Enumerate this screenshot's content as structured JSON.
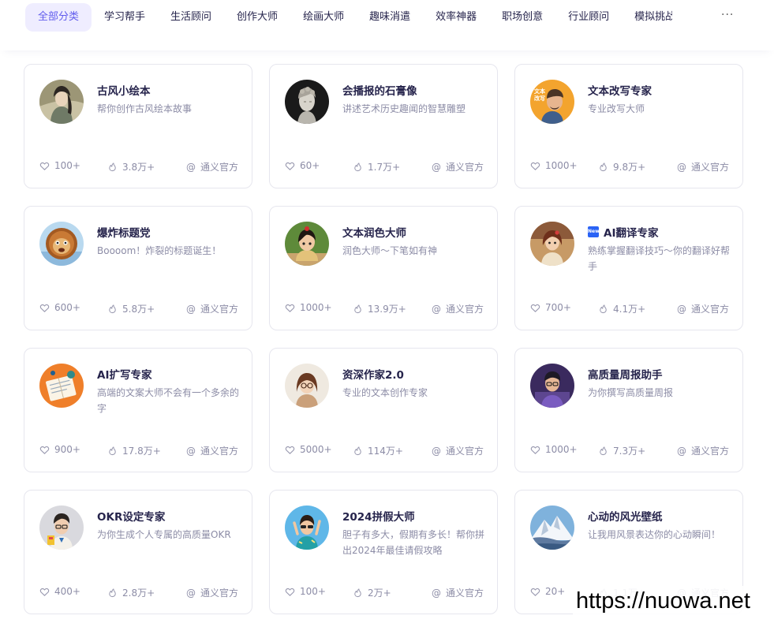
{
  "tabs": [
    {
      "label": "全部分类",
      "active": true
    },
    {
      "label": "学习帮手",
      "active": false
    },
    {
      "label": "生活顾问",
      "active": false
    },
    {
      "label": "创作大师",
      "active": false
    },
    {
      "label": "绘画大师",
      "active": false
    },
    {
      "label": "趣味消遣",
      "active": false
    },
    {
      "label": "效率神器",
      "active": false
    },
    {
      "label": "职场创意",
      "active": false
    },
    {
      "label": "行业顾问",
      "active": false
    },
    {
      "label": "模拟挑战",
      "active": false
    }
  ],
  "more_label": "···",
  "icons": {
    "like": "heart-icon",
    "uses": "fire-icon",
    "author": "at-icon"
  },
  "colors": {
    "accent": "#615ced",
    "active_tab_bg": "#efedff",
    "card_border": "#e6e6ee",
    "muted_text": "#8c8ca6"
  },
  "cards": [
    {
      "title": "古风小绘本",
      "desc": "帮你创作古风绘本故事",
      "likes": "100+",
      "uses": "3.8万+",
      "author": "通义官方",
      "avatar": "ancient-scholar-avatar",
      "new_badge": false
    },
    {
      "title": "会播报的石膏像",
      "desc": "讲述艺术历史趣闻的智慧雕塑",
      "likes": "60+",
      "uses": "1.7万+",
      "author": "通义官方",
      "avatar": "plaster-statue-avatar",
      "new_badge": false
    },
    {
      "title": "文本改写专家",
      "desc": "专业改写大师",
      "likes": "1000+",
      "uses": "9.8万+",
      "author": "通义官方",
      "avatar": "rewrite-expert-avatar",
      "avatar_text": "文本\n改写",
      "new_badge": false
    },
    {
      "title": "爆炸标题党",
      "desc": "Boooom！炸裂的标题诞生！",
      "likes": "600+",
      "uses": "5.8万+",
      "author": "通义官方",
      "avatar": "lion-avatar",
      "new_badge": false
    },
    {
      "title": "文本润色大师",
      "desc": "润色大师～下笔如有神",
      "likes": "1000+",
      "uses": "13.9万+",
      "author": "通义官方",
      "avatar": "writer-girl-avatar",
      "new_badge": false
    },
    {
      "title": "AI翻译专家",
      "desc": "熟练掌握翻译技巧～你的翻译好帮手",
      "likes": "700+",
      "uses": "4.1万+",
      "author": "通义官方",
      "avatar": "translator-avatar",
      "new_badge": true,
      "new_badge_text": "New"
    },
    {
      "title": "AI扩写专家",
      "desc": "高端的文案大师不会有一个多余的字",
      "likes": "900+",
      "uses": "17.8万+",
      "author": "通义官方",
      "avatar": "notebook-avatar",
      "new_badge": false
    },
    {
      "title": "资深作家2.0",
      "desc": "专业的文本创作专家",
      "likes": "5000+",
      "uses": "114万+",
      "author": "通义官方",
      "avatar": "senior-writer-avatar",
      "new_badge": false
    },
    {
      "title": "高质量周报助手",
      "desc": "为你撰写高质量周报",
      "likes": "1000+",
      "uses": "7.3万+",
      "author": "通义官方",
      "avatar": "office-worker-avatar",
      "new_badge": false
    },
    {
      "title": "OKR设定专家",
      "desc": "为你生成个人专属的高质量OKR",
      "likes": "400+",
      "uses": "2.8万+",
      "author": "通义官方",
      "avatar": "okr-man-avatar",
      "new_badge": false
    },
    {
      "title": "2024拼假大师",
      "desc": "胆子有多大，假期有多长！帮你拼出2024年最佳请假攻略",
      "likes": "100+",
      "uses": "2万+",
      "author": "通义官方",
      "avatar": "holiday-man-avatar",
      "new_badge": false
    },
    {
      "title": "心动的风光壁纸",
      "desc": "让我用风景表达你的心动瞬间！",
      "likes": "20+",
      "uses": "1.1万+",
      "author": "通义官方",
      "avatar": "mountain-avatar",
      "new_badge": false
    }
  ],
  "watermark": "https://nuowa.net"
}
